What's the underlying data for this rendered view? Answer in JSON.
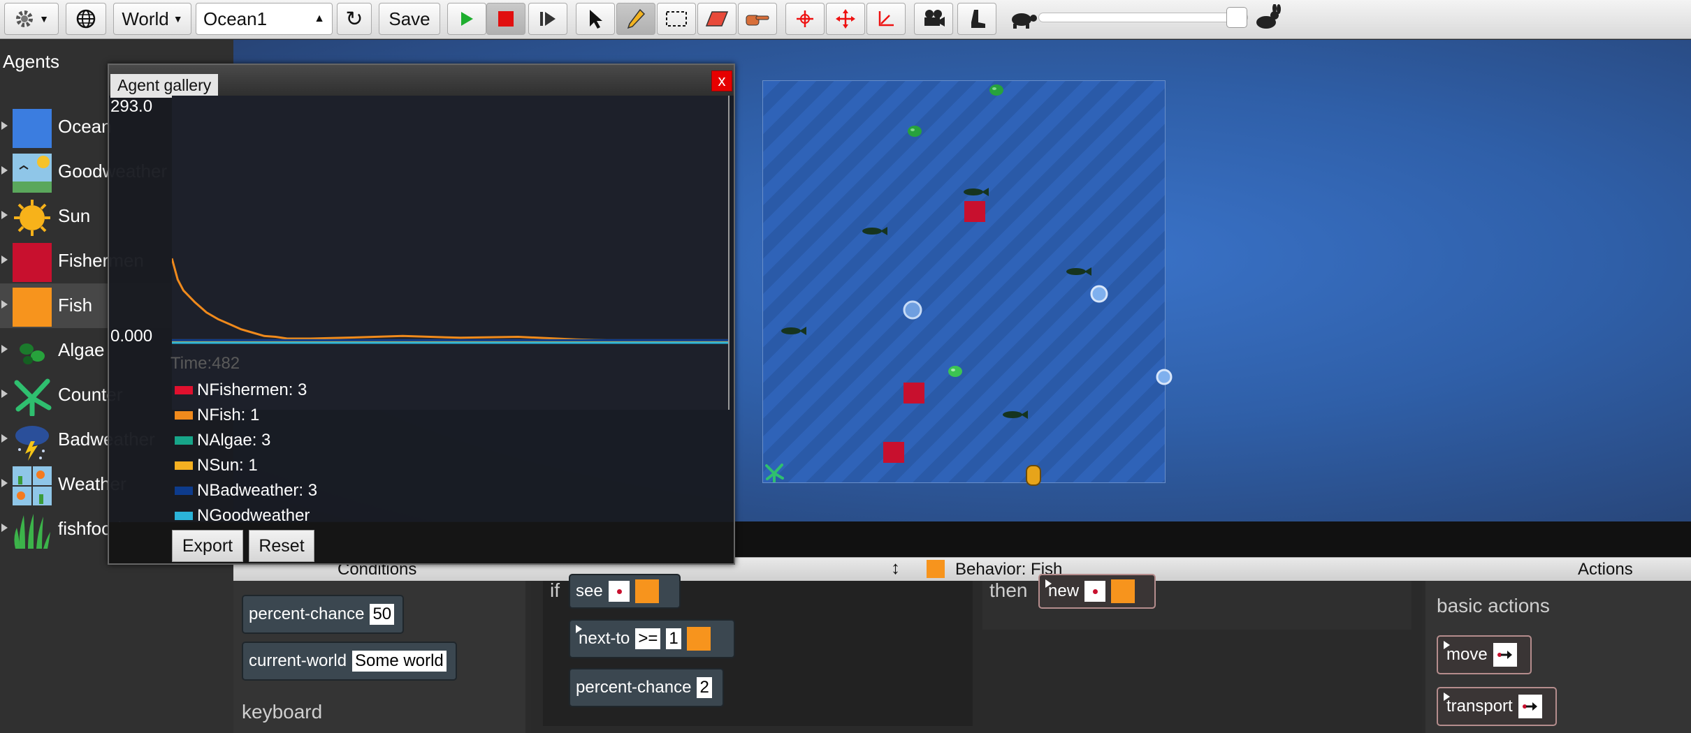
{
  "toolbar": {
    "world_label": "World",
    "world_select": "Ocean1",
    "save_label": "Save"
  },
  "agents_panel": {
    "title": "Agents",
    "items": [
      {
        "label": "Ocean",
        "icon": "ocean-swatch"
      },
      {
        "label": "Goodweather",
        "icon": "goodweather-image"
      },
      {
        "label": "Sun",
        "icon": "sun-image"
      },
      {
        "label": "Fishermen",
        "icon": "fishermen-swatch"
      },
      {
        "label": "Fish",
        "icon": "fish-swatch"
      },
      {
        "label": "Algae",
        "icon": "algae-image"
      },
      {
        "label": "Counter",
        "icon": "counter-image"
      },
      {
        "label": "Badweather",
        "icon": "badweather-image"
      },
      {
        "label": "Weather",
        "icon": "weather-image"
      },
      {
        "label": "fishfood",
        "icon": "fishfood-image"
      }
    ],
    "colors": {
      "ocean": "#3b7de0",
      "fishermen": "#c8102e",
      "fish": "#f7941d"
    }
  },
  "popup": {
    "tab_label": "Agent gallery",
    "close_label": "x",
    "ymax": "293.0",
    "ymin": "0.000",
    "time": "Time:482",
    "legend": [
      {
        "label": "NFishermen: 3",
        "color": "#e0102e"
      },
      {
        "label": "NFish: 1",
        "color": "#f08a1c"
      },
      {
        "label": "NAlgae: 3",
        "color": "#17a589"
      },
      {
        "label": "NSun: 1",
        "color": "#f5b021"
      },
      {
        "label": "NBadweather: 3",
        "color": "#0d3b8c"
      },
      {
        "label": "NGoodweather",
        "color": "#2bb3d8"
      }
    ],
    "export_label": "Export",
    "reset_label": "Reset"
  },
  "chart_data": {
    "type": "line",
    "ylim": [
      0,
      293
    ],
    "xlim": [
      0,
      482
    ],
    "series": [
      {
        "name": "NFishermen",
        "color": "#e0102e",
        "x": [
          0,
          100,
          200,
          300,
          400,
          482
        ],
        "y": [
          3,
          3,
          3,
          3,
          3,
          3
        ]
      },
      {
        "name": "NFish",
        "color": "#f08a1c",
        "x": [
          0,
          5,
          10,
          20,
          30,
          40,
          50,
          60,
          70,
          80,
          90,
          100,
          120,
          150,
          200,
          250,
          300,
          350,
          400,
          482
        ],
        "y": [
          100,
          75,
          62,
          48,
          36,
          28,
          22,
          16,
          12,
          8,
          7,
          5,
          5,
          6,
          8,
          6,
          7,
          4,
          2,
          1
        ]
      },
      {
        "name": "NAlgae",
        "color": "#17a589",
        "x": [
          0,
          100,
          200,
          300,
          400,
          482
        ],
        "y": [
          3,
          3,
          3,
          3,
          3,
          3
        ]
      },
      {
        "name": "NSun",
        "color": "#f5b021",
        "x": [
          0,
          100,
          200,
          300,
          400,
          482
        ],
        "y": [
          1,
          1,
          1,
          1,
          1,
          1
        ]
      },
      {
        "name": "NBadweather",
        "color": "#0d3b8c",
        "x": [
          0,
          100,
          200,
          300,
          400,
          482
        ],
        "y": [
          3,
          3,
          3,
          3,
          3,
          3
        ]
      },
      {
        "name": "NGoodweather",
        "color": "#2bb3d8",
        "x": [
          0,
          100,
          200,
          300,
          400,
          482
        ],
        "y": [
          0,
          0,
          0,
          0,
          0,
          0
        ]
      }
    ]
  },
  "behavior": {
    "conditions_label": "Conditions",
    "behavior_label": "Behavior: Fish",
    "actions_label": "Actions",
    "palette": {
      "percent_chance_label": "percent-chance",
      "percent_chance_value": "50",
      "current_world_label": "current-world",
      "current_world_value": "Some world",
      "keyboard_label": "keyboard"
    },
    "rule": {
      "if_label": "if",
      "see_label": "see",
      "next_to_label": "next-to",
      "next_to_op": ">=",
      "next_to_value": "1",
      "percent_chance_label": "percent-chance",
      "percent_chance_value": "2",
      "then_label": "then",
      "new_label": "new"
    },
    "actions_palette": {
      "section_label": "basic actions",
      "move_label": "move",
      "transport_label": "transport"
    }
  }
}
